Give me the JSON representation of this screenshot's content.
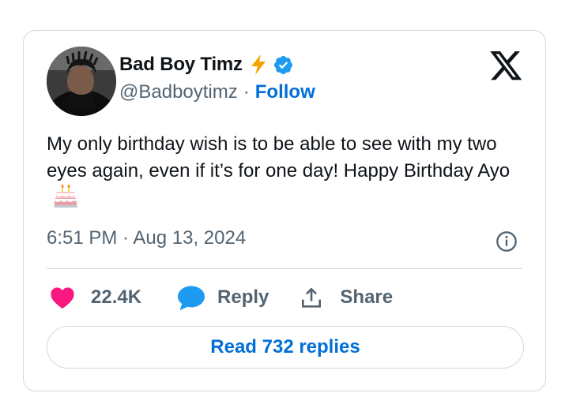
{
  "author": {
    "display_name": "Bad Boy Timz",
    "handle": "@Badboytimz",
    "separator": "·",
    "follow_label": "Follow"
  },
  "tweet": {
    "text": "My only birthday wish is to be able to see with my two eyes again, even if it’s for one day! Happy Birthday Ayo",
    "emoji": "birthday-cake-icon",
    "timestamp": "6:51 PM · Aug 13, 2024"
  },
  "actions": {
    "like_count": "22.4K",
    "reply_label": "Reply",
    "share_label": "Share"
  },
  "read_replies_label": "Read 732 replies",
  "icons": [
    "bolt-icon",
    "verified-icon",
    "x-logo-icon",
    "info-icon",
    "heart-icon",
    "reply-bubble-icon",
    "share-icon",
    "birthday-cake-icon"
  ],
  "colors": {
    "link_blue": "#006fd6",
    "verified_blue": "#1d9bf0",
    "heart_pink": "#f91880",
    "muted_text": "#536471",
    "border": "#cfd9de",
    "bolt_orange": "#f4a300"
  }
}
